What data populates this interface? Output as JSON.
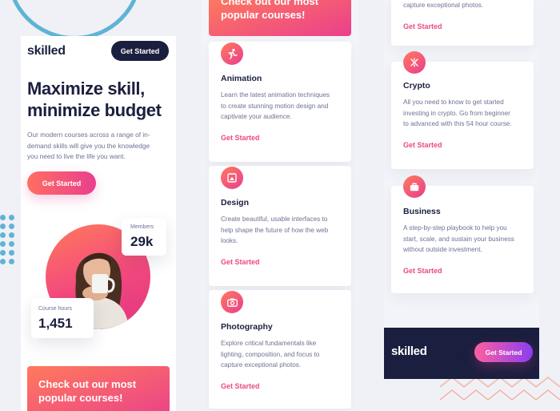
{
  "brand": "skilled",
  "colors": {
    "navy": "#1b1f3f",
    "accent_start": "#ff6f61",
    "accent_end": "#e93e8f",
    "link": "#ec4b7c",
    "decoration": "#5fb3d6"
  },
  "hero": {
    "cta_header": "Get Started",
    "headline_line1": "Maximize skill,",
    "headline_line2": "minimize budget",
    "lead_line1": "Our modern courses across a range of in-",
    "lead_line2": "demand skills will give you the knowledge",
    "lead_line3": "you need to live the life you want.",
    "cta": "Get Started"
  },
  "stats": {
    "members_label": "Members",
    "members_value": "29k",
    "hours_label": "Course hours",
    "hours_value": "1,451"
  },
  "promo": {
    "line1": "Check out our most",
    "line2": "popular courses!"
  },
  "courses": [
    {
      "icon": "animation-icon",
      "title": "Animation",
      "desc1": "Learn the latest animation techniques",
      "desc2": "to create stunning motion design and",
      "desc3": "captivate your audience.",
      "link": "Get Started"
    },
    {
      "icon": "design-icon",
      "title": "Design",
      "desc1": "Create beautiful, usable interfaces to",
      "desc2": "help shape the future of how the web",
      "desc3": "looks.",
      "link": "Get Started"
    },
    {
      "icon": "camera-icon",
      "title": "Photography",
      "desc1": "Explore critical fundamentals like",
      "desc2": "lighting, composition, and focus to",
      "desc3": "capture exceptional photos.",
      "link": "Get Started"
    },
    {
      "icon": "crypto-icon",
      "title": "Crypto",
      "desc1": "All you need to know to get started",
      "desc2": "investing in crypto. Go from beginner",
      "desc3": "to advanced with this 54 hour course.",
      "link": "Get Started"
    },
    {
      "icon": "briefcase-icon",
      "title": "Business",
      "desc1": "A step-by-step playbook to help you",
      "desc2": "start, scale, and sustain your business",
      "desc3": "without outside investment.",
      "link": "Get Started"
    }
  ],
  "col3_top": {
    "desc_tail": "capture exceptional photos.",
    "link": "Get Started"
  },
  "footer": {
    "logo": "skilled",
    "cta": "Get Started"
  }
}
